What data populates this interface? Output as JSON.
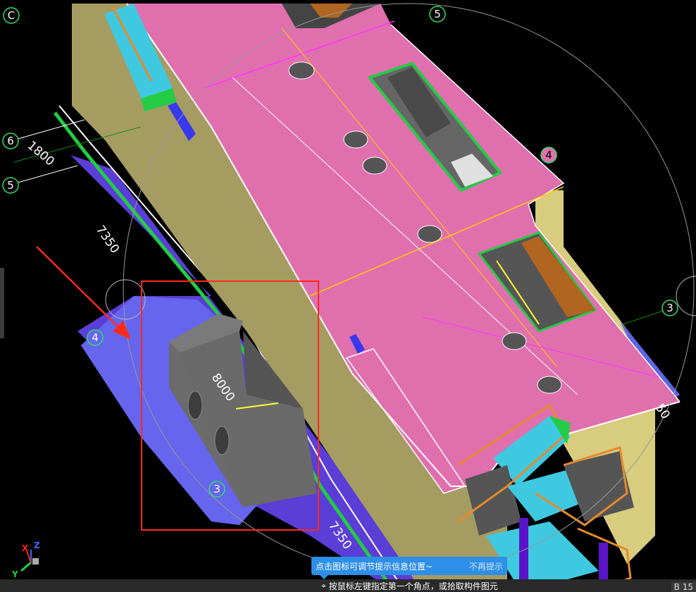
{
  "grid_bubbles": {
    "c_top_left": "C",
    "five_top": "5",
    "six_left": "6",
    "five_left": "5",
    "four_right_upper": "4",
    "four_left": "4",
    "three_right": "3",
    "three_bottom": "3"
  },
  "dimensions": {
    "d1800": "1800",
    "d7350_left": "7350",
    "d8000": "8000",
    "d7350_bottom": "7350",
    "d50_right": "50"
  },
  "axis": {
    "x": "X",
    "y": "Y",
    "z": "Z"
  },
  "tooltip": {
    "message": "点击图标可调节提示信息位置~",
    "dismiss": "不再提示"
  },
  "status": {
    "prompt": "按鼠标左键指定第一个角点，或拾取构件图元",
    "corner": "B 15"
  },
  "colors": {
    "background": "#000000",
    "roof_slab": "#e06fae",
    "wall": "#a59c62",
    "wall_light": "#d8cc7e",
    "base_slab": "#6565ee",
    "gray_block": "#6b6b6b",
    "stair": "#3ec9e0",
    "railing": "#e68a2e",
    "column": "#5a14c8",
    "green_edge": "#22cc44",
    "selection_box": "#ff2a1a",
    "tooltip_bg": "#2e8fe8"
  }
}
